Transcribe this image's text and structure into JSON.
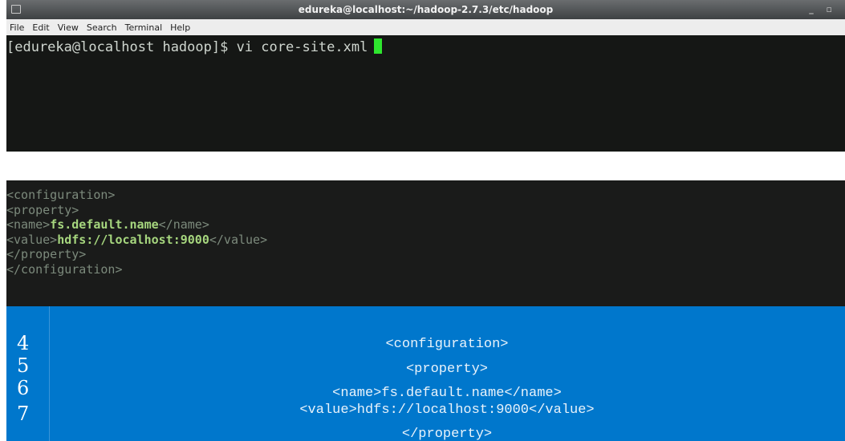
{
  "terminal": {
    "title": "edureka@localhost:~/hadoop-2.7.3/etc/hadoop",
    "menu": [
      "File",
      "Edit",
      "View",
      "Search",
      "Terminal",
      "Help"
    ],
    "window_controls": "_ ▫",
    "command_line": "[edureka@localhost hadoop]$ vi core-site.xml"
  },
  "code_dark": {
    "lines": [
      {
        "tag_open": "<configuration>",
        "value": "",
        "tag_close": ""
      },
      {
        "tag_open": "<property>",
        "value": "",
        "tag_close": ""
      },
      {
        "tag_open": "<name>",
        "value": "fs.default.name",
        "tag_close": "</name>"
      },
      {
        "tag_open": "<value>",
        "value": "hdfs://localhost:9000",
        "tag_close": "</value>"
      },
      {
        "tag_open": "</property>",
        "value": "",
        "tag_close": ""
      },
      {
        "tag_open": "</configuration>",
        "value": "",
        "tag_close": ""
      }
    ]
  },
  "code_blue": {
    "line_numbers": [
      "4",
      "5",
      "6",
      "7"
    ],
    "lines": [
      "<configuration>",
      "<property>",
      "<name>fs.default.name</name>",
      "<value>hdfs://localhost:9000</value>",
      "</property>"
    ]
  },
  "colors": {
    "terminal_bg": "#151715",
    "cursor": "#2ee62e",
    "code_dark_bg": "#1a1b1a",
    "code_blue_bg": "#0077cc",
    "xml_value": "#a6d67e"
  }
}
